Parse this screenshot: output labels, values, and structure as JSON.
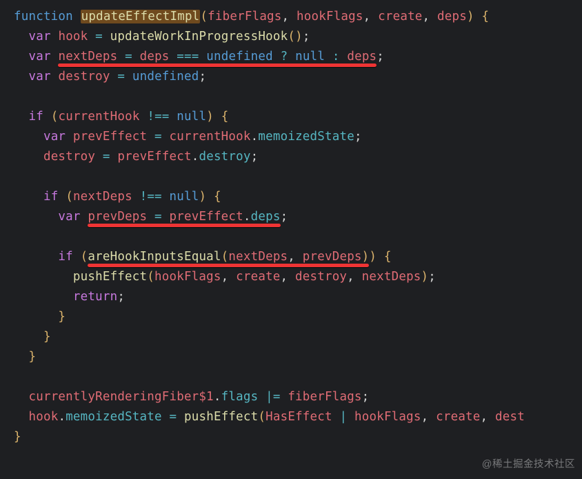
{
  "code": {
    "l1": {
      "kw": "function",
      "fn": "updateEffectImpl",
      "p1": "fiberFlags",
      "p2": "hookFlags",
      "p3": "create",
      "p4": "deps"
    },
    "l2": {
      "kw": "var",
      "v": "hook",
      "fn": "updateWorkInProgressHook"
    },
    "l3": {
      "kw": "var",
      "v": "nextDeps",
      "d": "deps",
      "u": "undefined",
      "n": "null",
      "d2": "deps"
    },
    "l4": {
      "kw": "var",
      "v": "destroy",
      "u": "undefined"
    },
    "l5": {
      "kw": "if",
      "v": "currentHook",
      "n": "null"
    },
    "l6": {
      "kw": "var",
      "v": "prevEffect",
      "obj": "currentHook",
      "prop": "memoizedState"
    },
    "l7": {
      "v": "destroy",
      "obj": "prevEffect",
      "prop": "destroy"
    },
    "l8": {
      "kw": "if",
      "v": "nextDeps",
      "n": "null"
    },
    "l9": {
      "kw": "var",
      "v": "prevDeps",
      "obj": "prevEffect",
      "prop": "deps"
    },
    "l10": {
      "kw": "if",
      "fn": "areHookInputsEqual",
      "a1": "nextDeps",
      "a2": "prevDeps"
    },
    "l11": {
      "fn": "pushEffect",
      "a1": "hookFlags",
      "a2": "create",
      "a3": "destroy",
      "a4": "nextDeps"
    },
    "l12": {
      "kw": "return"
    },
    "l13": {
      "obj": "currentlyRenderingFiber$1",
      "prop": "flags",
      "v": "fiberFlags"
    },
    "l14": {
      "obj": "hook",
      "prop": "memoizedState",
      "fn": "pushEffect",
      "a1": "HasEffect",
      "a2": "hookFlags",
      "a3": "create",
      "a4": "dest"
    }
  },
  "watermark": "@稀土掘金技术社区"
}
